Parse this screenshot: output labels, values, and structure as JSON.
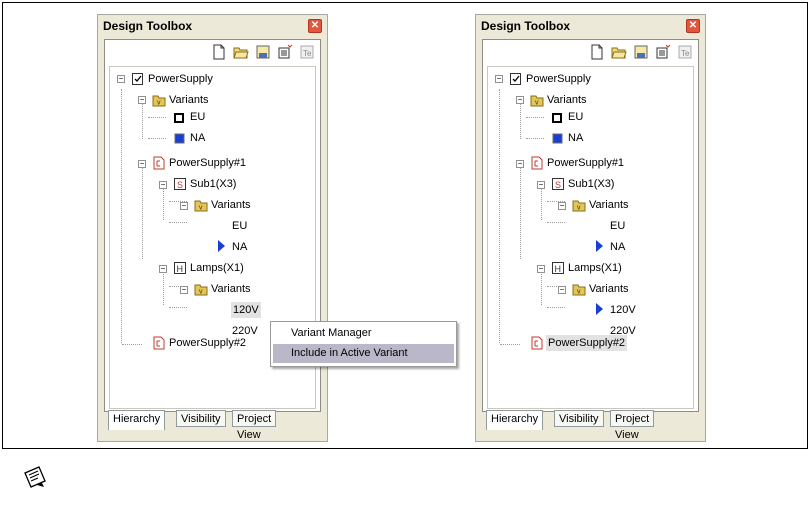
{
  "panels": [
    {
      "title": "Design Toolbox",
      "tree": {
        "root": "PowerSupply",
        "variants_label": "Variants",
        "variants": [
          "EU",
          "NA"
        ],
        "ps1": "PowerSupply#1",
        "sub1": "Sub1(X3)",
        "sub1_variants_label": "Variants",
        "sub1_variants": [
          "EU",
          "NA"
        ],
        "lamps": "Lamps(X1)",
        "lamps_variants_label": "Variants",
        "lamps_variants": [
          "120V",
          "220V"
        ],
        "ps2": "PowerSupply#2"
      },
      "tabs": [
        "Hierarchy",
        "Visibility",
        "Project View"
      ],
      "context_menu": [
        "Variant Manager",
        "Include in Active Variant"
      ]
    },
    {
      "title": "Design Toolbox",
      "tree": {
        "root": "PowerSupply",
        "variants_label": "Variants",
        "variants": [
          "EU",
          "NA"
        ],
        "ps1": "PowerSupply#1",
        "sub1": "Sub1(X3)",
        "sub1_variants_label": "Variants",
        "sub1_variants": [
          "EU",
          "NA"
        ],
        "lamps": "Lamps(X1)",
        "lamps_variants_label": "Variants",
        "lamps_variants": [
          "120V",
          "220V"
        ],
        "ps2": "PowerSupply#2"
      },
      "tabs": [
        "Hierarchy",
        "Visibility",
        "Project View"
      ]
    }
  ],
  "colors": {
    "active_variant": "#1a3fd0",
    "selection": "#e2e2e2",
    "menu_highlight": "#b9b7c8"
  },
  "icons": [
    "close-icon",
    "new-file-icon",
    "open-folder-icon",
    "save-icon",
    "properties-icon",
    "text-icon",
    "note-icon"
  ]
}
